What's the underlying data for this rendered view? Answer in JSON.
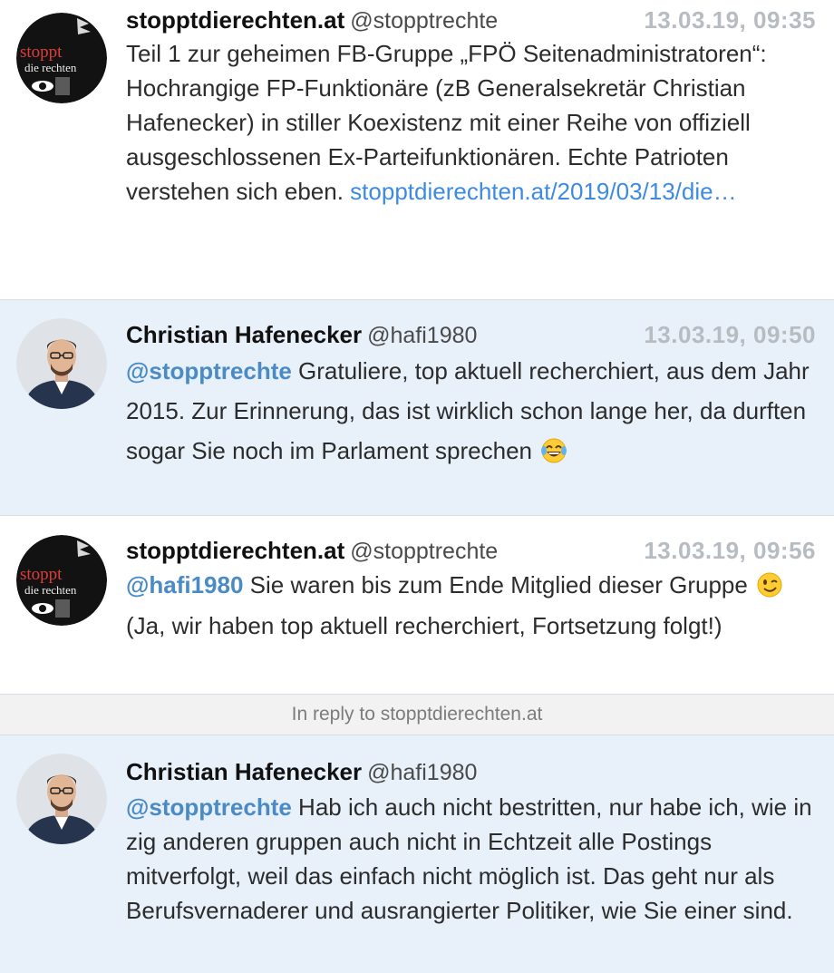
{
  "colors": {
    "mention": "#4a8bc6",
    "link": "#3d8be0",
    "timestamp": "#b7bcc2",
    "highlight_bg": "#e8f0fa"
  },
  "tweets": [
    {
      "name": "stopptdierechten.at",
      "handle": "@stopptrechte",
      "time": "13.03.19, 09:35",
      "avatar": "stoppt-logo",
      "avatar_text": {
        "line1": "stoppt",
        "line2": "die rechten"
      },
      "text": "Teil 1 zur geheimen FB-Gruppe „FPÖ Seitenadministratoren“: Hochrangige FP-Funktionäre (zB Generalsekretär Christian Hafenecker) in stiller Koexistenz mit einer Reihe von offiziell ausgeschlossenen Ex-Parteifunktionären. Echte Patrioten verstehen sich eben.",
      "link": "stopptdierechten.at/​2019/03/13/die…"
    },
    {
      "name": "Christian Hafenecker",
      "handle": "@hafi1980",
      "time": "13.03.19, 09:50",
      "avatar": "person-photo",
      "mention": "@stopptrechte",
      "text": "Gratuliere, top aktuell recherchiert, aus dem Jahr 2015. Zur Erinnerung, das ist wirklich schon lange her, da durften sogar Sie noch im Parlament sprechen",
      "emoji": "laughing-tears-emoji"
    },
    {
      "name": "stopptdierechten.at",
      "handle": "@stopptrechte",
      "time": "13.03.19, 09:56",
      "avatar": "stoppt-logo",
      "avatar_text": {
        "line1": "stoppt",
        "line2": "die rechten"
      },
      "mention": "@hafi1980",
      "text_before": "Sie waren bis zum Ende Mitglied dieser Gruppe",
      "emoji": "winking-face-emoji",
      "text_after": "(Ja, wir haben top aktuell recherchiert, Fortsetzung folgt!)"
    },
    {
      "name": "Christian Hafenecker",
      "handle": "@hafi1980",
      "avatar": "person-photo",
      "mention": "@stopptrechte",
      "text": "Hab ich auch nicht bestritten, nur habe ich, wie in zig anderen gruppen auch nicht in Echtzeit alle Postings mitverfolgt, weil das einfach nicht möglich ist. Das geht nur als Berufsvernaderer und ausrangierter Politiker, wie Sie einer sind."
    }
  ],
  "reply_bar": "In reply to stopptdierechten.at"
}
